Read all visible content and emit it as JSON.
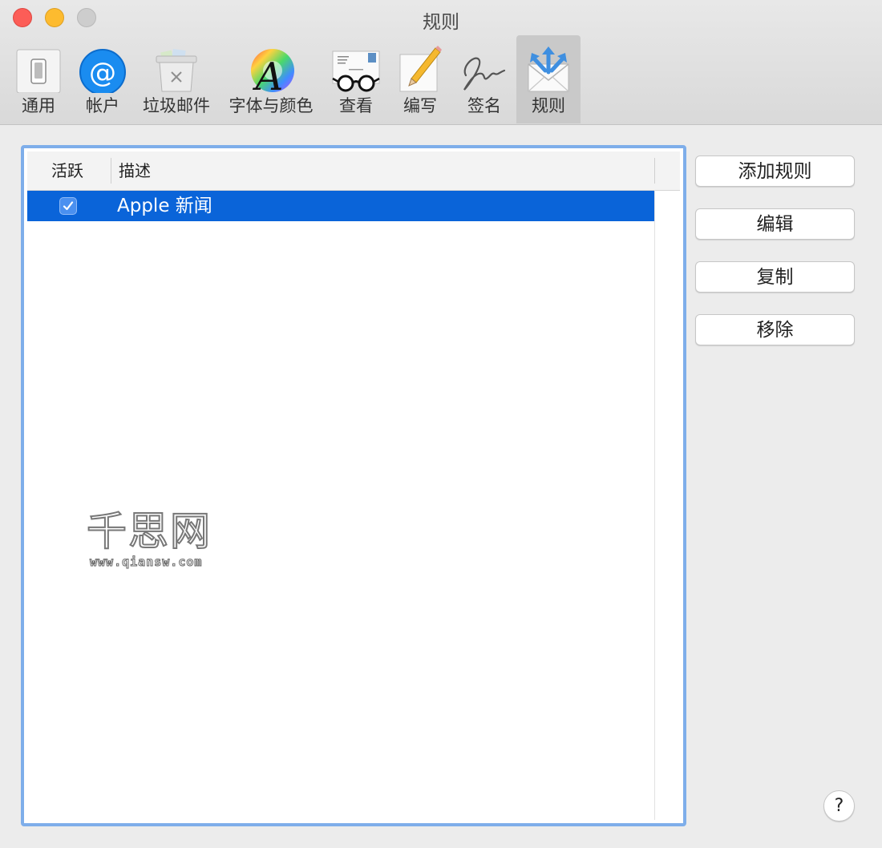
{
  "window": {
    "title": "规则"
  },
  "toolbar": {
    "items": [
      {
        "label": "通用",
        "icon": "switch-icon"
      },
      {
        "label": "帐户",
        "icon": "at-sign-icon"
      },
      {
        "label": "垃圾邮件",
        "icon": "trash-icon"
      },
      {
        "label": "字体与颜色",
        "icon": "font-color-icon"
      },
      {
        "label": "查看",
        "icon": "glasses-letter-icon"
      },
      {
        "label": "编写",
        "icon": "pencil-paper-icon"
      },
      {
        "label": "签名",
        "icon": "signature-icon"
      },
      {
        "label": "规则",
        "icon": "rules-envelope-icon",
        "selected": true
      }
    ]
  },
  "table": {
    "columns": [
      "活跃",
      "描述"
    ],
    "rows": [
      {
        "active": true,
        "description": "Apple 新闻",
        "selected": true
      }
    ]
  },
  "buttons": {
    "add_rule": "添加规则",
    "edit": "编辑",
    "duplicate": "复制",
    "remove": "移除",
    "help": "?"
  },
  "watermark": {
    "title": "千思网",
    "url": "www.qiansw.com"
  },
  "colors": {
    "selection": "#0a64d9",
    "focus_ring": "#7eaeea",
    "close": "#fc5d57",
    "minimize": "#fdbb2f"
  }
}
